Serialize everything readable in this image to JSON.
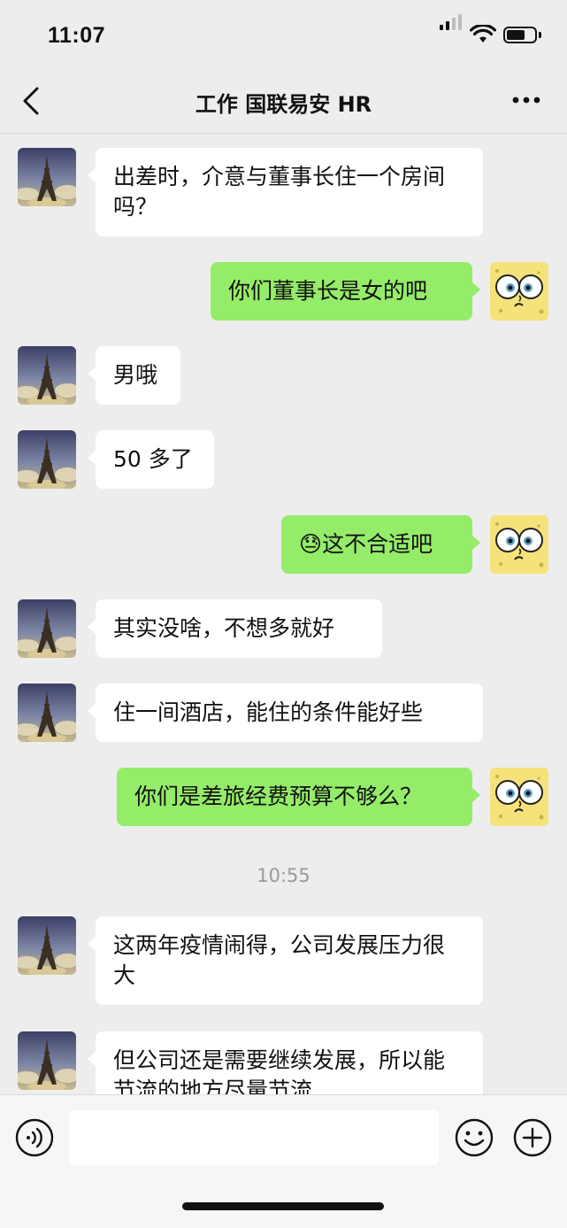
{
  "status_bar": {
    "time": "11:07"
  },
  "header": {
    "title": "工作 国联易安 HR"
  },
  "messages": [
    {
      "side": "in",
      "text": "出差时，介意与董事长住一个房间吗？"
    },
    {
      "side": "out",
      "text": "你们董事长是女的吧"
    },
    {
      "side": "in",
      "text": "男哦"
    },
    {
      "side": "in",
      "text": "50 多了"
    },
    {
      "side": "out",
      "emoji": "😓",
      "text": "这不合适吧"
    },
    {
      "side": "in",
      "text": "其实没啥，不想多就好"
    },
    {
      "side": "in",
      "text": "住一间酒店，能住的条件能好些"
    },
    {
      "side": "out",
      "text": "你们是差旅经费预算不够么？"
    },
    {
      "side": "in",
      "text": "这两年疫情闹得，公司发展压力很大"
    },
    {
      "side": "in",
      "text": "但公司还是需要继续发展，所以能节流的地方尽量节流"
    }
  ],
  "timestamp": "10:55",
  "icons": {
    "back": "chevron-left-icon",
    "more": "more-dots-icon",
    "voice": "voice-icon",
    "emoji": "emoji-icon",
    "add": "plus-icon",
    "contact_avatar": "eiffel-tower-avatar",
    "my_avatar": "spongebob-avatar"
  },
  "colors": {
    "background": "#ededed",
    "incoming_bubble": "#ffffff",
    "outgoing_bubble": "#95ec69",
    "timestamp": "#9a9a9a"
  },
  "input": {
    "value": ""
  }
}
